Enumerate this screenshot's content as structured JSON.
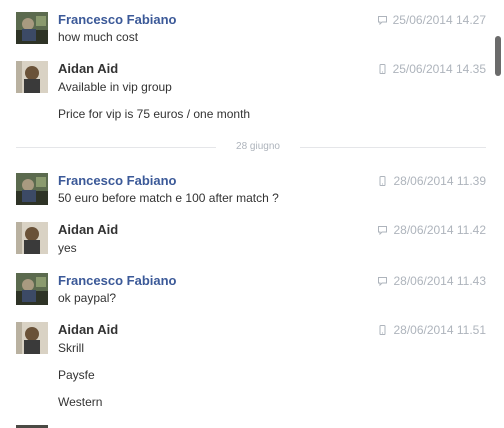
{
  "conversation": {
    "messages": [
      {
        "sender": "Francesco Fabiano",
        "timestamp": "25/06/2014 14.27",
        "device": "chat-bubble-icon",
        "avatar": "francesco",
        "lines": [
          "how much cost"
        ]
      },
      {
        "sender": "Aidan Aid",
        "timestamp": "25/06/2014 14.35",
        "device": "mobile-phone-icon",
        "avatar": "aidan",
        "lines": [
          "Available in vip group",
          "Price for vip is 75 euros / one month"
        ]
      },
      {
        "sender": "Francesco Fabiano",
        "timestamp": "28/06/2014 11.39",
        "device": "mobile-phone-icon",
        "avatar": "francesco",
        "lines": [
          "50 euro before match e 100 after match ?"
        ]
      },
      {
        "sender": "Aidan Aid",
        "timestamp": "28/06/2014 11.42",
        "device": "chat-bubble-icon",
        "avatar": "aidan",
        "lines": [
          "yes"
        ]
      },
      {
        "sender": "Francesco Fabiano",
        "timestamp": "28/06/2014 11.43",
        "device": "chat-bubble-icon",
        "avatar": "francesco",
        "lines": [
          "ok paypal?"
        ]
      },
      {
        "sender": "Aidan Aid",
        "timestamp": "28/06/2014 11.51",
        "device": "mobile-phone-icon",
        "avatar": "aidan",
        "lines": [
          "Skrill",
          "Paysfe",
          "Western"
        ]
      }
    ],
    "date_divider": "28 giugno"
  },
  "colors": {
    "sender_link": "#3b5998",
    "sender_dark": "#333333",
    "meta_text": "#aeb4bc",
    "divider": "#e5e6e9"
  }
}
